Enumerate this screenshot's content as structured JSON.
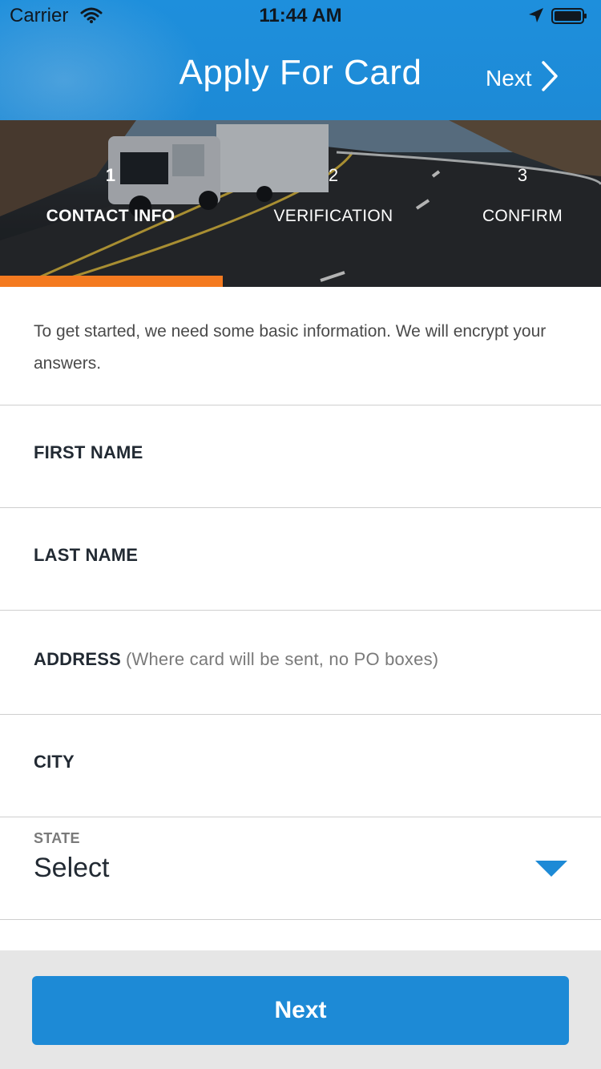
{
  "status_bar": {
    "carrier": "Carrier",
    "time": "11:44 AM"
  },
  "header": {
    "title": "Apply For Card",
    "next_label": "Next"
  },
  "stepper": {
    "steps": [
      {
        "number": "1",
        "label": "CONTACT INFO",
        "active": true
      },
      {
        "number": "2",
        "label": "VERIFICATION",
        "active": false
      },
      {
        "number": "3",
        "label": "CONFIRM",
        "active": false
      }
    ],
    "progress": 0.37
  },
  "form": {
    "intro": "To get started, we need some basic information. We will encrypt your answers.",
    "first_name_label": "FIRST NAME",
    "last_name_label": "LAST NAME",
    "address_label": "ADDRESS",
    "address_hint": "(Where card will be sent, no PO boxes)",
    "city_label": "CITY",
    "state_label": "STATE",
    "state_value": "Select"
  },
  "footer": {
    "next_button": "Next"
  },
  "colors": {
    "primary": "#1d8ad6",
    "accent": "#f47a20",
    "footer_bg": "#e6e6e6"
  },
  "icons": {
    "wifi": "wifi-icon",
    "location": "location-arrow-icon",
    "battery": "battery-icon",
    "next_chevron": "chevron-right-icon",
    "dropdown": "caret-down-icon"
  }
}
